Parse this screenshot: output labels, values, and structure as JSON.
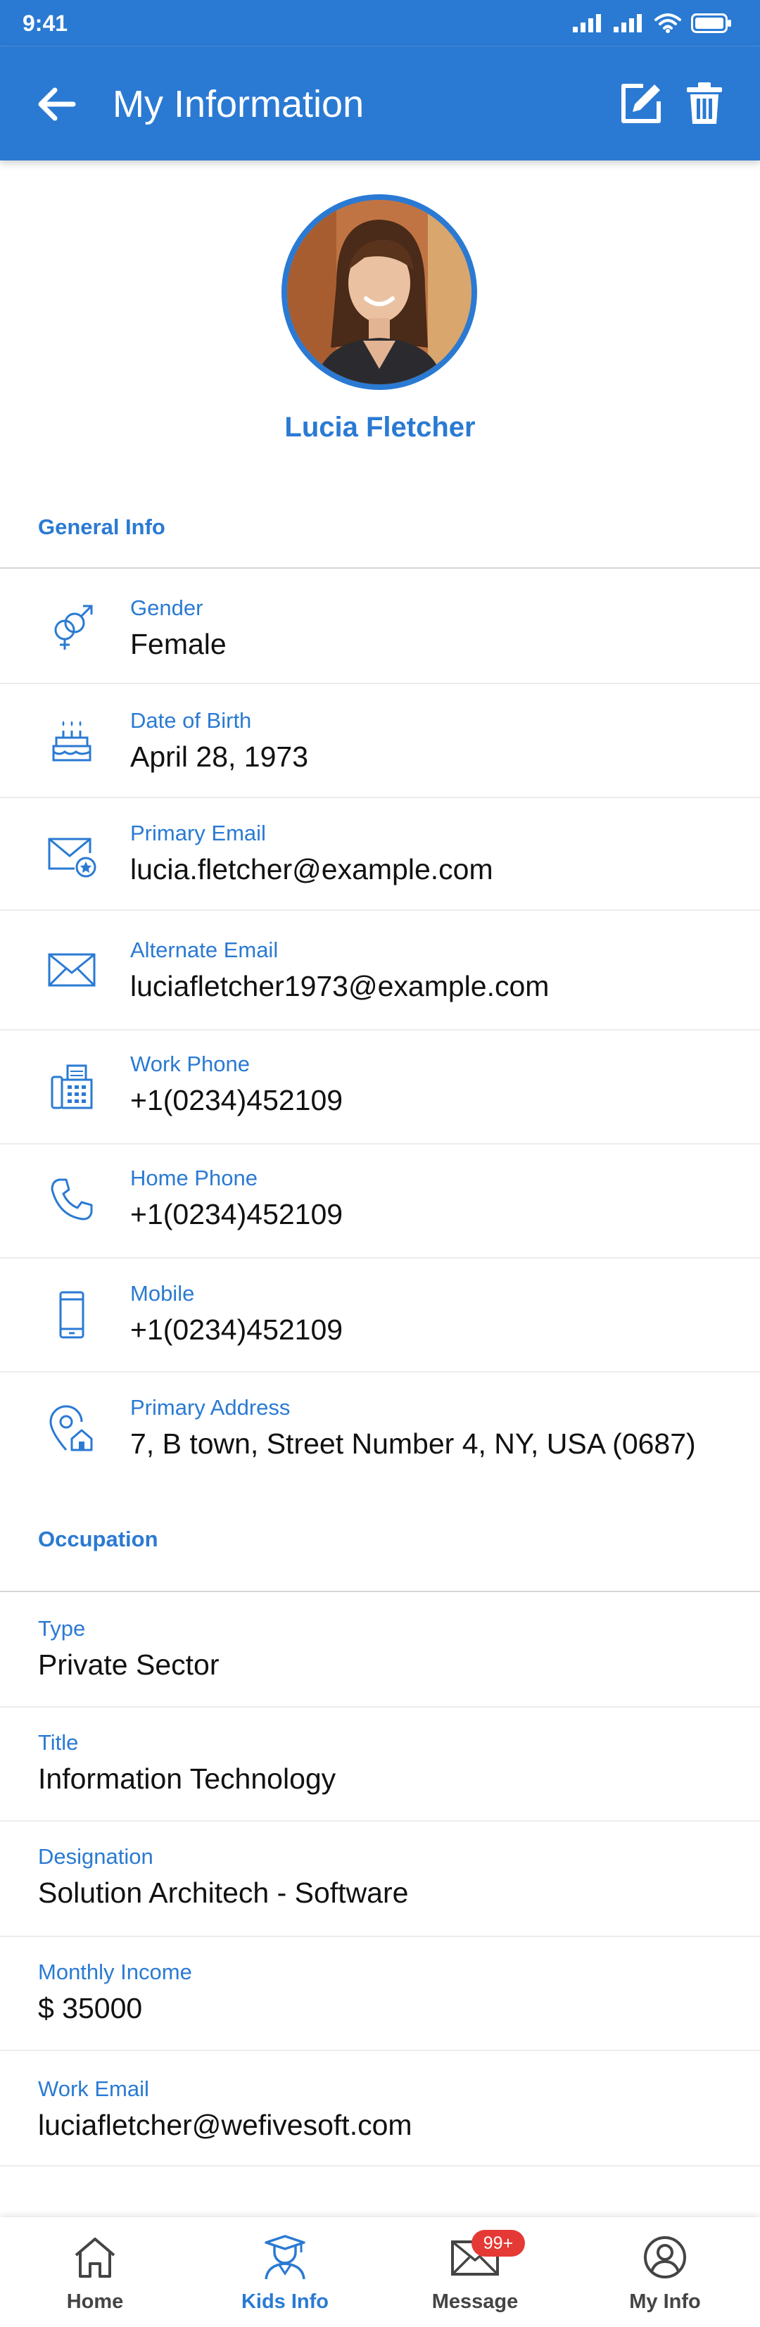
{
  "status_bar": {
    "time": "9:41"
  },
  "app_bar": {
    "title": "My Information"
  },
  "profile": {
    "name": "Lucia Fletcher"
  },
  "general_info": {
    "heading": "General Info",
    "fields": [
      {
        "label": "Gender",
        "value": "Female",
        "icon": "gender-icon"
      },
      {
        "label": "Date of Birth",
        "value": "April 28, 1973",
        "icon": "birthday-cake-icon"
      },
      {
        "label": "Primary Email",
        "value": "lucia.fletcher@example.com",
        "icon": "email-star-icon"
      },
      {
        "label": "Alternate Email",
        "value": "luciafletcher1973@example.com",
        "icon": "email-icon"
      },
      {
        "label": "Work Phone",
        "value": "+1(0234)452109",
        "icon": "office-phone-icon"
      },
      {
        "label": "Home Phone",
        "value": "+1(0234)452109",
        "icon": "phone-icon"
      },
      {
        "label": "Mobile",
        "value": "+1(0234)452109",
        "icon": "mobile-icon"
      },
      {
        "label": "Primary Address",
        "value": "7, B town, Street Number 4, NY, USA (0687)",
        "icon": "home-location-icon"
      }
    ]
  },
  "occupation": {
    "heading": "Occupation",
    "fields": [
      {
        "label": "Type",
        "value": "Private Sector"
      },
      {
        "label": "Title",
        "value": "Information Technology"
      },
      {
        "label": "Designation",
        "value": "Solution Architech - Software"
      },
      {
        "label": "Monthly Income",
        "value": "$ 35000"
      },
      {
        "label": "Work Email",
        "value": "luciafletcher@wefivesoft.com"
      }
    ]
  },
  "bottom_nav": {
    "items": [
      {
        "label": "Home",
        "icon": "home-icon"
      },
      {
        "label": "Kids Info",
        "icon": "graduate-icon",
        "active": true
      },
      {
        "label": "Message",
        "icon": "mail-icon"
      },
      {
        "label": "My Info",
        "icon": "user-circle-icon"
      }
    ],
    "message_badge": "99+"
  },
  "colors": {
    "primary": "#2a7ad3",
    "badge": "#e53935"
  }
}
